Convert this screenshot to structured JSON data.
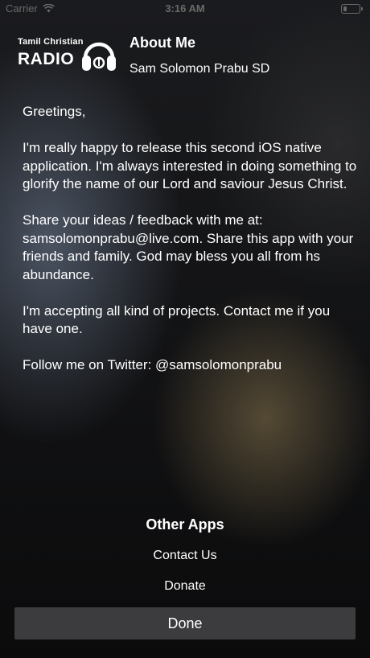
{
  "status_bar": {
    "carrier": "Carrier",
    "time": "3:16 AM",
    "wifi_icon": "wifi-icon",
    "battery_icon": "battery-icon"
  },
  "header": {
    "logo": {
      "line1": "Tamil Christian",
      "line2": "RADIO",
      "icon": "headphone-icon"
    },
    "title": "About Me",
    "subtitle": "Sam Solomon Prabu SD"
  },
  "content": {
    "paragraphs": [
      "Greetings,",
      "I'm really happy to release this second iOS native application. I'm always interested in doing something to glorify the name of our Lord and saviour Jesus Christ.",
      "Share your ideas / feedback with me at: samsolomonprabu@live.com. Share this app with your friends and family. God may bless you all from hs abundance.",
      "I'm accepting all kind of projects. Contact me if you have one.",
      "Follow me on Twitter: @samsolomonprabu"
    ]
  },
  "footer": {
    "other_apps": "Other Apps",
    "contact_us": "Contact Us",
    "donate": "Donate",
    "done": "Done"
  },
  "colors": {
    "text": "#ffffff",
    "button_bg": "#3c3c3e",
    "status_text": "#6a6a6a"
  }
}
